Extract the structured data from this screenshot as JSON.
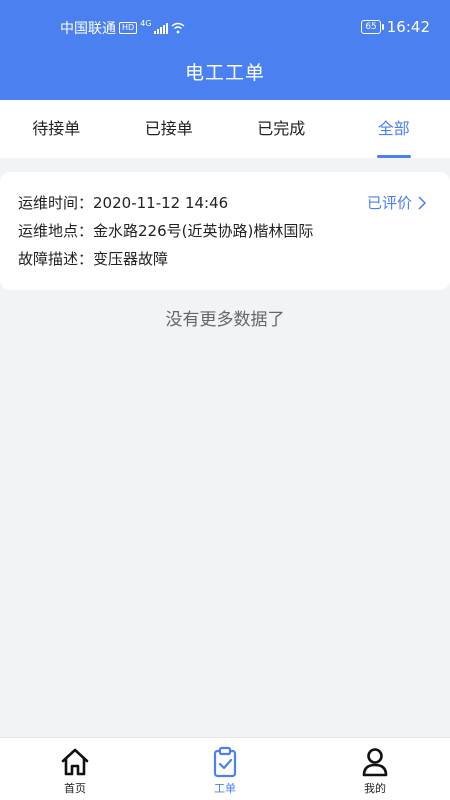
{
  "status_bar": {
    "carrier": "中国联通",
    "hd": "HD",
    "network": "4G",
    "battery": "65",
    "time": "16:42"
  },
  "header": {
    "title": "电工工单"
  },
  "tabs": [
    {
      "label": "待接单",
      "active": false
    },
    {
      "label": "已接单",
      "active": false
    },
    {
      "label": "已完成",
      "active": false
    },
    {
      "label": "全部",
      "active": true
    }
  ],
  "orders": [
    {
      "time_label": "运维时间：",
      "time_value": "2020-11-12 14:46",
      "location_label": "运维地点：",
      "location_value": "金水路226号(近英协路)楷林国际",
      "fault_label": "故障描述：",
      "fault_value": "变压器故障",
      "status": "已评价"
    }
  ],
  "list_end_text": "没有更多数据了",
  "bottom_nav": [
    {
      "label": "首页",
      "icon": "home-icon",
      "active": false
    },
    {
      "label": "工单",
      "icon": "clipboard-icon",
      "active": true
    },
    {
      "label": "我的",
      "icon": "user-icon",
      "active": false
    }
  ],
  "colors": {
    "primary": "#4b80f0",
    "background": "#f2f3f5"
  }
}
